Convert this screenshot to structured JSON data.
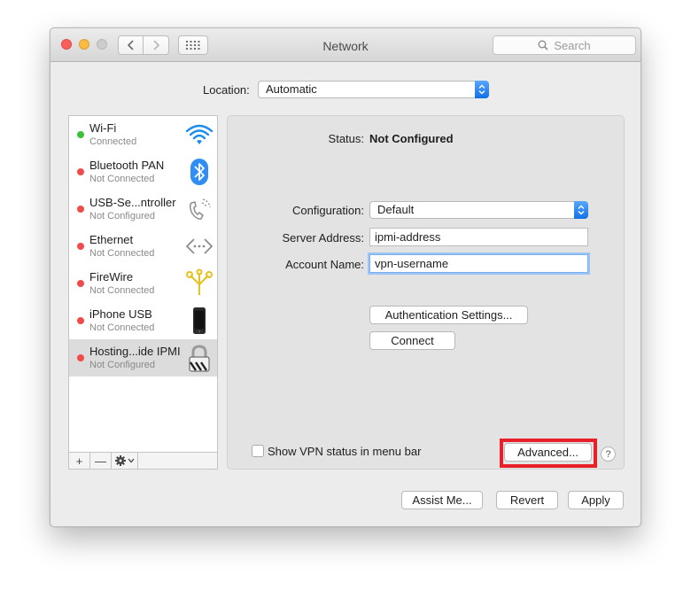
{
  "window": {
    "title": "Network"
  },
  "search": {
    "placeholder": "Search"
  },
  "location": {
    "label": "Location:",
    "value": "Automatic"
  },
  "services": [
    {
      "name": "Wi-Fi",
      "status": "Connected",
      "dot_color": "#3cc13b",
      "icon": "wifi-icon"
    },
    {
      "name": "Bluetooth PAN",
      "status": "Not Connected",
      "dot_color": "#f04b4b",
      "icon": "bluetooth-icon"
    },
    {
      "name": "USB-Se...ntroller",
      "status": "Not Configured",
      "dot_color": "#f04b4b",
      "icon": "phone-icon"
    },
    {
      "name": "Ethernet",
      "status": "Not Connected",
      "dot_color": "#f04b4b",
      "icon": "ethernet-icon"
    },
    {
      "name": "FireWire",
      "status": "Not Connected",
      "dot_color": "#f04b4b",
      "icon": "firewire-icon"
    },
    {
      "name": "iPhone USB",
      "status": "Not Connected",
      "dot_color": "#f04b4b",
      "icon": "iphone-icon"
    },
    {
      "name": "Hosting...ide IPMI",
      "status": "Not Configured",
      "dot_color": "#f04b4b",
      "icon": "vpn-lock-icon",
      "selected": true
    }
  ],
  "sidebar_toolbar": {
    "add": "+",
    "remove": "—"
  },
  "detail": {
    "status_label": "Status:",
    "status_value": "Not Configured",
    "configuration_label": "Configuration:",
    "configuration_value": "Default",
    "server_label": "Server Address:",
    "server_value": "ipmi-address",
    "account_label": "Account Name:",
    "account_value": "vpn-username",
    "auth_button": "Authentication Settings...",
    "connect_button": "Connect",
    "show_vpn_label": "Show VPN status in menu bar",
    "advanced_button": "Advanced...",
    "help": "?"
  },
  "footer": {
    "assist": "Assist Me...",
    "revert": "Revert",
    "apply": "Apply"
  },
  "colors": {
    "accent": "#1170e6",
    "highlight": "#e8202a"
  }
}
